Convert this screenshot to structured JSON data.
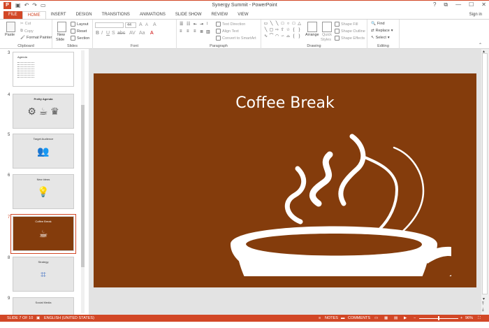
{
  "window": {
    "app_icon": "P",
    "title": "Synergy Summit - PowerPoint",
    "qat_icons": [
      "save-icon",
      "undo-icon",
      "redo-icon",
      "present-icon"
    ],
    "controls": {
      "help": "?",
      "ribbon_display": "⧉",
      "minimize": "—",
      "maximize": "☐",
      "close": "✕"
    }
  },
  "tabs": [
    "FILE",
    "HOME",
    "INSERT",
    "DESIGN",
    "TRANSITIONS",
    "ANIMATIONS",
    "SLIDE SHOW",
    "REVIEW",
    "VIEW"
  ],
  "active_tab": "HOME",
  "sign_in": "Sign in",
  "ribbon": {
    "clipboard": {
      "label": "Clipboard",
      "paste": "Paste",
      "cut": "Cut",
      "copy": "Copy",
      "format_painter": "Format Painter"
    },
    "slides": {
      "label": "Slides",
      "new_slide_line1": "New",
      "new_slide_line2": "Slide",
      "layout": "Layout",
      "reset": "Reset",
      "section": "Section"
    },
    "font": {
      "label": "Font",
      "font_size": "44"
    },
    "paragraph": {
      "label": "Paragraph",
      "text_direction": "Text Direction",
      "align_text": "Align Text",
      "convert_smartart": "Convert to SmartArt"
    },
    "drawing": {
      "label": "Drawing",
      "arrange": "Arrange",
      "quick_styles_line1": "Quick",
      "quick_styles_line2": "Styles",
      "shape_fill": "Shape Fill",
      "shape_outline": "Shape Outline",
      "shape_effects": "Shape Effects"
    },
    "editing": {
      "label": "Editing",
      "find": "Find",
      "replace": "Replace",
      "select": "Select"
    }
  },
  "thumbnails": [
    {
      "num": "3",
      "title": "Agenda",
      "style": "white"
    },
    {
      "num": "4",
      "title": "Pretty Agenda",
      "style": "gray"
    },
    {
      "num": "5",
      "title": "Target Audience",
      "style": "gray"
    },
    {
      "num": "6",
      "title": "New ideas",
      "style": "gray"
    },
    {
      "num": "7",
      "title": "Coffee Break",
      "style": "brown",
      "selected": true
    },
    {
      "num": "8",
      "title": "Strategy",
      "style": "gray"
    },
    {
      "num": "9",
      "title": "Social Media",
      "style": "gray"
    }
  ],
  "slide": {
    "title": "Coffee Break",
    "background": "#843c0c",
    "graphic": "coffee-cup-icon"
  },
  "status": {
    "slide_info": "SLIDE 7 OF 10",
    "language": "ENGLISH (UNITED STATES)",
    "notes": "NOTES",
    "comments": "COMMENTS",
    "zoom": "96%",
    "zoom_out": "−",
    "zoom_in": "+"
  },
  "colors": {
    "accent": "#d24726",
    "slide_bg": "#843c0c"
  }
}
